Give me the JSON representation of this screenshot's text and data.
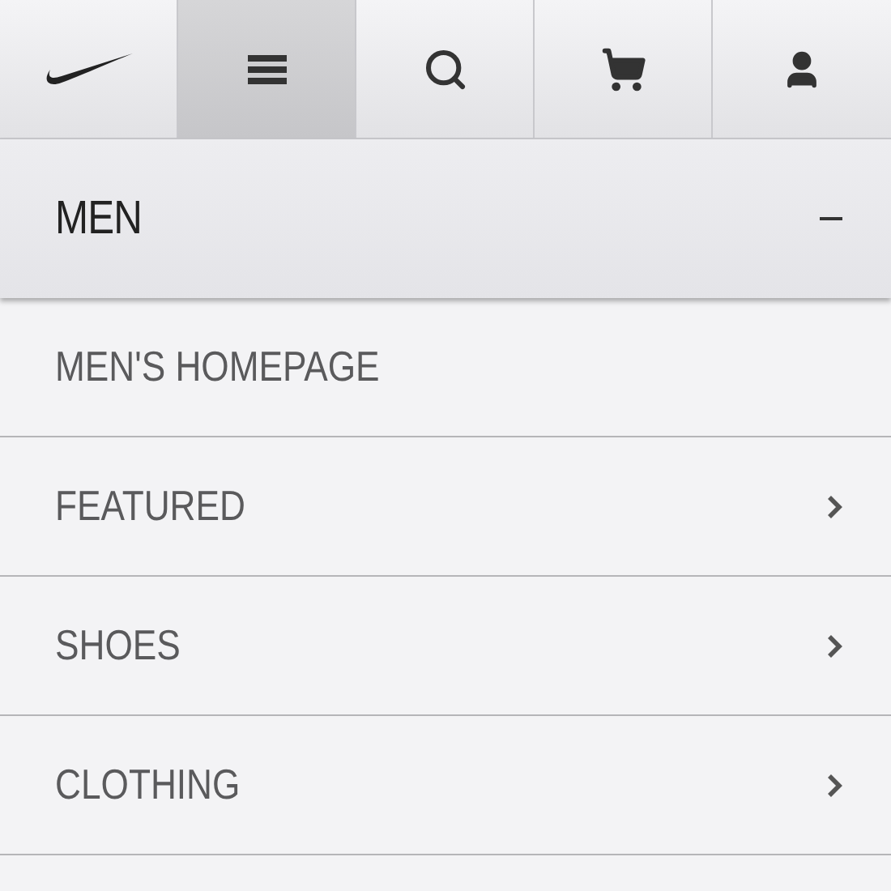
{
  "toolbar": [
    {
      "kind": "logo",
      "selected": false
    },
    {
      "kind": "menu",
      "selected": true
    },
    {
      "kind": "search",
      "selected": false
    },
    {
      "kind": "cart",
      "selected": false
    },
    {
      "kind": "account",
      "selected": false
    }
  ],
  "section": {
    "title": "MEN",
    "expanded": true
  },
  "items": [
    {
      "label": "MEN'S HOMEPAGE",
      "has_children": false
    },
    {
      "label": "FEATURED",
      "has_children": true
    },
    {
      "label": "SHOES",
      "has_children": true
    },
    {
      "label": "CLOTHING",
      "has_children": true
    }
  ]
}
